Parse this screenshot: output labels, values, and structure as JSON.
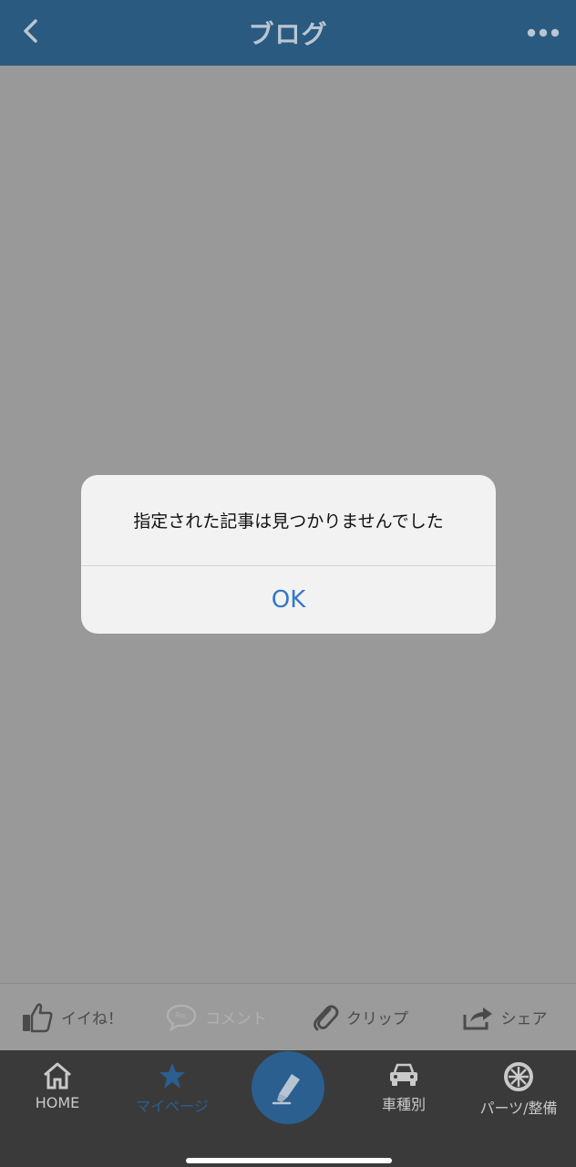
{
  "header": {
    "title": "ブログ"
  },
  "dialog": {
    "message": "指定された記事は見つかりませんでした",
    "ok_label": "OK"
  },
  "actions": [
    {
      "label": "イイね！",
      "icon": "thumbs-up-icon"
    },
    {
      "label": "コメント",
      "icon": "comment-bubble-icon"
    },
    {
      "label": "クリップ",
      "icon": "paperclip-icon"
    },
    {
      "label": "シェア",
      "icon": "share-arrow-icon"
    }
  ],
  "tabs": [
    {
      "label": "HOME",
      "icon": "home-icon"
    },
    {
      "label": "マイページ",
      "icon": "star-icon"
    },
    {
      "label": "車種別",
      "icon": "car-icon"
    },
    {
      "label": "パーツ/整備",
      "icon": "wheel-icon"
    }
  ],
  "colors": {
    "header_bg": "#2a5a80",
    "overlay": "#999999",
    "tab_bar_bg": "#3a3a3a",
    "accent": "#2a5f8f",
    "ok_text": "#3478c6"
  }
}
